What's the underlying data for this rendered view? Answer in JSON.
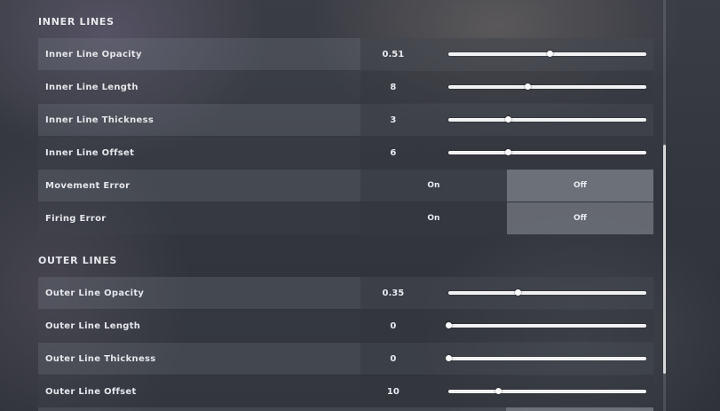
{
  "sections": [
    {
      "title": "INNER LINES",
      "rows": [
        {
          "type": "slider",
          "label": "Inner Line Opacity",
          "value": "0.51",
          "fraction": 0.51
        },
        {
          "type": "slider",
          "label": "Inner Line Length",
          "value": "8",
          "fraction": 0.4
        },
        {
          "type": "slider",
          "label": "Inner Line Thickness",
          "value": "3",
          "fraction": 0.3
        },
        {
          "type": "slider",
          "label": "Inner Line Offset",
          "value": "6",
          "fraction": 0.3
        },
        {
          "type": "toggle",
          "label": "Movement Error",
          "on_label": "On",
          "off_label": "Off",
          "selected": "Off"
        },
        {
          "type": "toggle",
          "label": "Firing Error",
          "on_label": "On",
          "off_label": "Off",
          "selected": "Off"
        }
      ]
    },
    {
      "title": "OUTER LINES",
      "rows": [
        {
          "type": "slider",
          "label": "Outer Line Opacity",
          "value": "0.35",
          "fraction": 0.35
        },
        {
          "type": "slider",
          "label": "Outer Line Length",
          "value": "0",
          "fraction": 0.0
        },
        {
          "type": "slider",
          "label": "Outer Line Thickness",
          "value": "0",
          "fraction": 0.0
        },
        {
          "type": "slider",
          "label": "Outer Line Offset",
          "value": "10",
          "fraction": 0.25
        }
      ]
    }
  ]
}
